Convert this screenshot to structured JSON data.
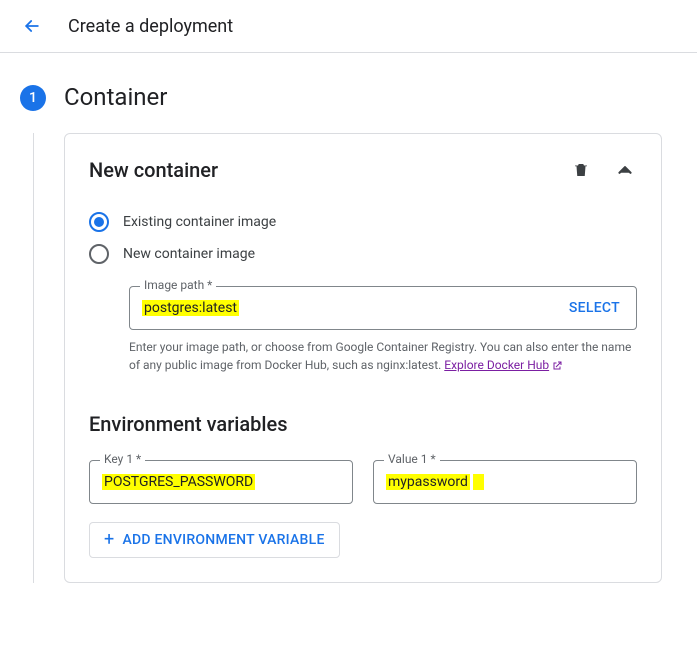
{
  "header": {
    "title": "Create a deployment"
  },
  "step": {
    "number": "1",
    "title": "Container"
  },
  "card": {
    "title": "New container",
    "radios": {
      "existing": "Existing container image",
      "newimg": "New container image"
    },
    "imagePath": {
      "label": "Image path *",
      "value": "postgres:latest",
      "selectLabel": "SELECT",
      "helper": "Enter your image path, or choose from Google Container Registry. You can also enter the name of any public image from Docker Hub, such as nginx:latest. ",
      "helperLink": "Explore Docker Hub"
    },
    "envTitle": "Environment variables",
    "env": [
      {
        "keyLabel": "Key 1 *",
        "key": "POSTGRES_PASSWORD",
        "valueLabel": "Value 1 *",
        "value": "mypassword"
      }
    ],
    "addEnvLabel": "ADD ENVIRONMENT VARIABLE"
  }
}
